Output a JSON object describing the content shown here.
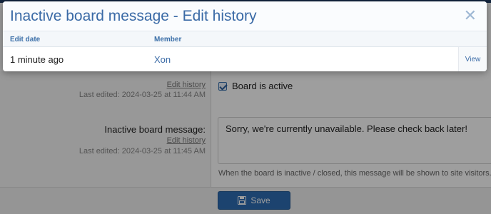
{
  "modal": {
    "title": "Inactive board message - Edit history",
    "close_icon": "close-icon",
    "columns": {
      "edit_date": "Edit date",
      "member": "Member"
    },
    "rows": [
      {
        "edit_date": "1 minute ago",
        "member": "Xon",
        "action": "View"
      }
    ]
  },
  "form": {
    "board_active": {
      "edit_history_link": "Edit history",
      "last_edited": "Last edited: 2024-03-25 at 11:44 AM",
      "checkbox_label": "Board is active",
      "checked": true
    },
    "inactive_message": {
      "label": "Inactive board message:",
      "edit_history_link": "Edit history",
      "last_edited": "Last edited: 2024-03-25 at 11:45 AM",
      "value": "Sorry, we're currently unavailable. Please check back later!",
      "hint": "When the board is inactive / closed, this message will be shown to site visitors."
    },
    "save_label": "Save",
    "save_icon": "floppy-disk-icon"
  },
  "colors": {
    "accent": "#3a6aa6",
    "primary_button": "#2e6db3"
  }
}
